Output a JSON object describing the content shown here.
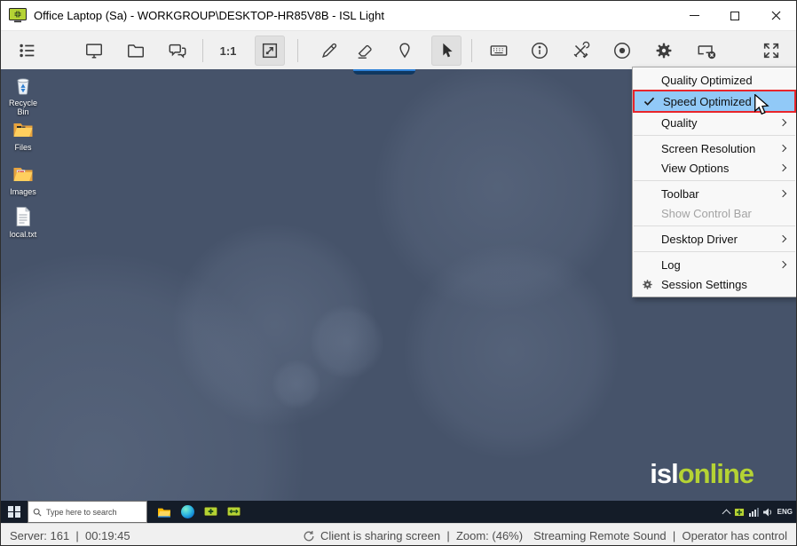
{
  "titlebar": {
    "title": "Office Laptop (Sa) - WORKGROUP\\DESKTOP-HR85V8B - ISL Light"
  },
  "toolbar": {
    "zoom_label": "1:1"
  },
  "menu": {
    "items": [
      {
        "label": "Quality Optimized",
        "submenu": false
      },
      {
        "label": "Speed Optimized",
        "submenu": false,
        "checked": true,
        "highlighted": true
      },
      {
        "label": "Quality",
        "submenu": true
      },
      {
        "label": "Screen Resolution",
        "submenu": true
      },
      {
        "label": "View Options",
        "submenu": true
      },
      {
        "label": "Toolbar",
        "submenu": true
      },
      {
        "label": "Show Control Bar",
        "submenu": false,
        "disabled": true
      },
      {
        "label": "Desktop Driver",
        "submenu": true
      },
      {
        "label": "Log",
        "submenu": true
      },
      {
        "label": "Session Settings",
        "submenu": false,
        "icon": "gear-icon"
      }
    ]
  },
  "desktop": {
    "icons": [
      {
        "label": "Recycle Bin"
      },
      {
        "label": "Files"
      },
      {
        "label": "Images"
      },
      {
        "label": "local.txt"
      }
    ],
    "logo": {
      "isl": "isl",
      "online": "online"
    }
  },
  "taskbar": {
    "search_placeholder": "Type here to search",
    "language": "ENG"
  },
  "statusbar": {
    "left": "Server: 161  |  00:19:45",
    "center": "Client is sharing screen  |  Zoom: (46%)",
    "right": "Streaming Remote Sound  |  Operator has control"
  },
  "colors": {
    "accent_green": "#b5d334",
    "highlight_blue": "#91c9f7",
    "alert_red": "#e8252b",
    "desktop_base": "#46536a"
  }
}
